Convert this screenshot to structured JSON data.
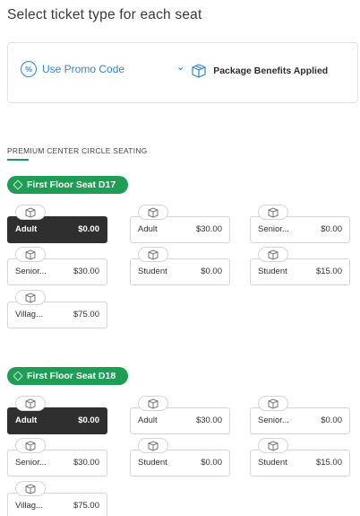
{
  "page": {
    "title": "Select ticket type for each seat"
  },
  "promo": {
    "icon": "percent-badge-icon",
    "label": "Use Promo Code",
    "package_label": "Package Benefits Applied",
    "package_icon": "package-box-icon"
  },
  "section": {
    "label": "PREMIUM CENTER CIRCLE SEATING"
  },
  "colors": {
    "accent_green": "#1f9d55",
    "link_blue": "#2f86d6",
    "selected_dark": "#2f2f2f"
  },
  "seats": [
    {
      "label": "First Floor Seat D17",
      "tickets": [
        {
          "name": "Adult",
          "price": "$0.00",
          "selected": true
        },
        {
          "name": "Adult",
          "price": "$30.00",
          "selected": false
        },
        {
          "name": "Senior...",
          "price": "$0.00",
          "selected": false
        },
        {
          "name": "Senior...",
          "price": "$30.00",
          "selected": false
        },
        {
          "name": "Student",
          "price": "$0.00",
          "selected": false
        },
        {
          "name": "Student",
          "price": "$15.00",
          "selected": false
        },
        {
          "name": "Villag...",
          "price": "$75.00",
          "selected": false
        }
      ]
    },
    {
      "label": "First Floor Seat D18",
      "tickets": [
        {
          "name": "Adult",
          "price": "$0.00",
          "selected": true
        },
        {
          "name": "Adult",
          "price": "$30.00",
          "selected": false
        },
        {
          "name": "Senior...",
          "price": "$0.00",
          "selected": false
        },
        {
          "name": "Senior...",
          "price": "$30.00",
          "selected": false
        },
        {
          "name": "Student",
          "price": "$0.00",
          "selected": false
        },
        {
          "name": "Student",
          "price": "$15.00",
          "selected": false
        },
        {
          "name": "Villag...",
          "price": "$75.00",
          "selected": false
        }
      ]
    }
  ]
}
